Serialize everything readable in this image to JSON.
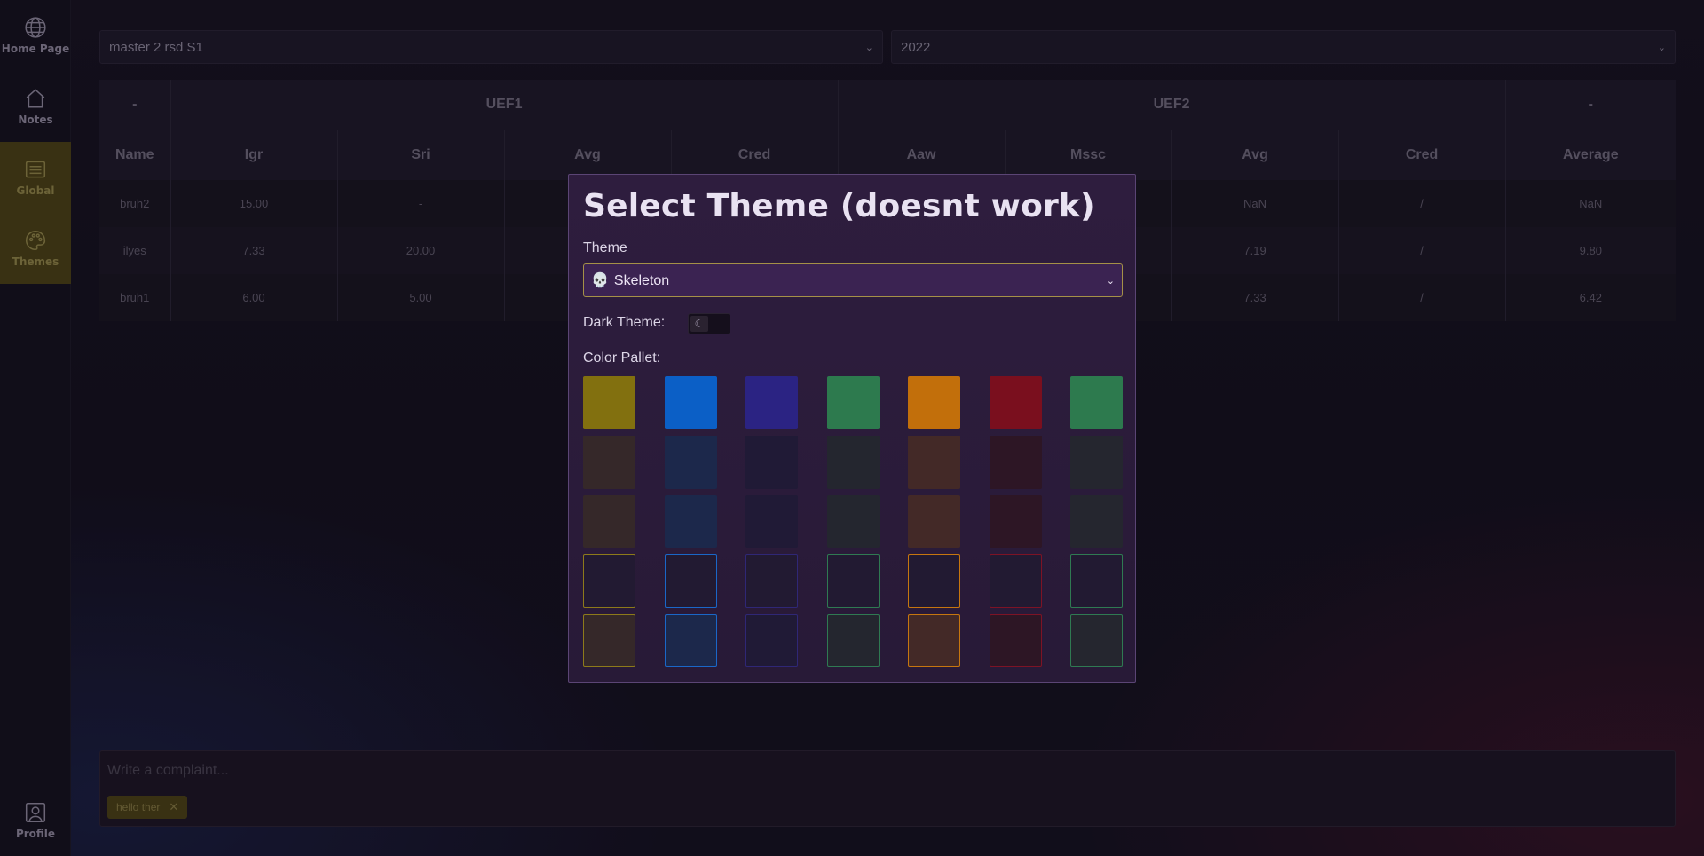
{
  "sidebar": {
    "items": [
      {
        "label": "Home Page",
        "icon": "globe-icon"
      },
      {
        "label": "Notes",
        "icon": "home-icon"
      },
      {
        "label": "Global",
        "icon": "list-icon"
      },
      {
        "label": "Themes",
        "icon": "palette-icon"
      }
    ],
    "profile": {
      "label": "Profile",
      "icon": "profile-icon"
    }
  },
  "filters": {
    "program": "master 2 rsd S1",
    "year": "2022"
  },
  "table": {
    "groups": [
      {
        "label": "-",
        "span": 1
      },
      {
        "label": "UEF1",
        "span": 4
      },
      {
        "label": "UEF2",
        "span": 4
      },
      {
        "label": "-",
        "span": 1
      }
    ],
    "columns": [
      "Name",
      "Igr",
      "Sri",
      "Avg",
      "Cred",
      "Aaw",
      "Mssc",
      "Avg",
      "Cred",
      "Average"
    ],
    "rows": [
      [
        "bruh2",
        "15.00",
        "-",
        "",
        "",
        "",
        "",
        "NaN",
        "/",
        "NaN"
      ],
      [
        "ilyes",
        "7.33",
        "20.00",
        "",
        "",
        "",
        "",
        "7.19",
        "/",
        "9.80"
      ],
      [
        "bruh1",
        "6.00",
        "5.00",
        "",
        "",
        "",
        "",
        "7.33",
        "/",
        "6.42"
      ]
    ]
  },
  "complaint": {
    "placeholder": "Write a complaint...",
    "tag": "hello ther"
  },
  "modal": {
    "title": "Select Theme (doesnt work)",
    "theme_label": "Theme",
    "theme_value": "Skeleton",
    "theme_icon": "💀",
    "dark_label": "Dark Theme:",
    "dark_enabled": false,
    "pallet_label": "Color Pallet:",
    "palette": [
      [
        "#82700f",
        "#0b5fc6",
        "#2b2383",
        "#2d7a4e",
        "#c26f0b",
        "#7a0f1e",
        "#2d7a4e"
      ],
      [
        "#352829",
        "#1c284b",
        "#201a36",
        "#24262f",
        "#432927",
        "#2d1625",
        "#25262f"
      ],
      [
        "#352829",
        "#1c284b",
        "#201a36",
        "#24262f",
        "#432927",
        "#2d1625",
        "#25262f"
      ],
      [
        "#221a32",
        "#221a32",
        "#221a32",
        "#221a32",
        "#221a32",
        "#221a32",
        "#221a32"
      ],
      [
        "#352829",
        "#1c284b",
        "#201a36",
        "#24262f",
        "#432927",
        "#2d1625",
        "#25262f"
      ]
    ],
    "palette_borders": [
      "#8d7a1a",
      "#1a67c8",
      "#2f2776",
      "#2f7a52",
      "#c6760f",
      "#7d1325",
      "#2f7a52"
    ]
  },
  "colors": {
    "accent": "#4a3f14",
    "modal_bg": "#2e1d3e",
    "select_border": "#a59147"
  }
}
